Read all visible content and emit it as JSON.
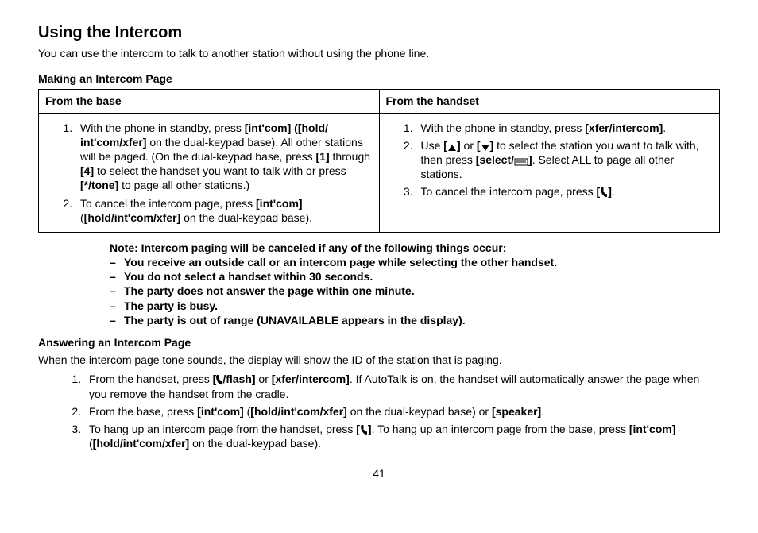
{
  "heading": "Using the Intercom",
  "intro": "You can use the intercom to talk to another station without using the phone line.",
  "making": {
    "title": "Making an Intercom Page",
    "col1": "From the base",
    "col2": "From the handset",
    "base_steps": [
      "With the phone in standby, press [int'com] ([hold/ int'com/xfer] on the dual-keypad base). All other stations will be paged. (On the dual-keypad base, press [1] through [4] to select the handset you want to talk with or press [*/tone] to page all other stations.)",
      "To cancel the intercom page, press [int'com] ([hold/int'com/xfer] on the dual-keypad base)."
    ],
    "handset_steps": [
      "With the phone in standby, press [xfer/intercom].",
      "Use [▲] or [▼] to select the station you want to talk with, then press [select/☐]. Select ALL to page all other stations.",
      "To cancel the intercom page, press [end-icon]."
    ]
  },
  "note": {
    "head": "Note: Intercom paging will be canceled if any of the following things occur:",
    "items": [
      "You receive an outside call or an intercom page while selecting the other handset.",
      "You do not select a handset within 30 seconds.",
      "The party does not answer the page within one minute.",
      "The party is busy.",
      "The party is out of range (UNAVAILABLE appears in the display)."
    ]
  },
  "answering": {
    "title": "Answering an Intercom Page",
    "intro": "When the intercom page tone sounds, the display will show the ID of the station that is paging.",
    "steps": [
      "From the handset, press [talk/flash] or [xfer/intercom]. If AutoTalk is on, the handset will automatically answer the page when you remove the handset from the cradle.",
      "From the base, press [int'com] ([hold/int'com/xfer] on the dual-keypad base) or [speaker].",
      "To hang up an intercom page from the handset, press [end-icon]. To hang up an intercom page from the base, press [int'com] ([hold/int'com/xfer]  on the dual-keypad base)."
    ]
  },
  "page_number": "41"
}
